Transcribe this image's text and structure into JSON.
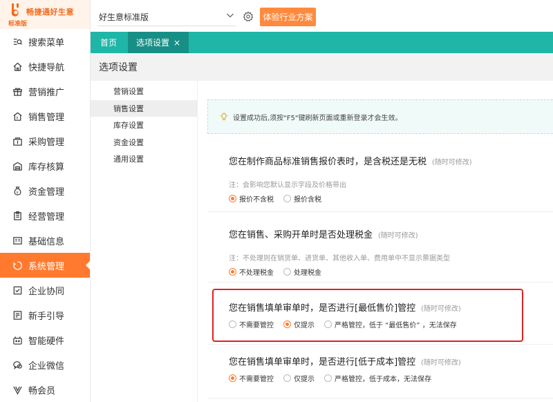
{
  "brand": {
    "name": "畅捷通好生意",
    "edition": "标准版",
    "accent": "#ff7a2e",
    "teal": "#1fb6a8"
  },
  "sidebar": {
    "items": [
      {
        "label": "搜索菜单",
        "icon": "search-menu-icon"
      },
      {
        "label": "快捷导航",
        "icon": "home-icon"
      },
      {
        "label": "营销推广",
        "icon": "gift-icon"
      },
      {
        "label": "销售管理",
        "icon": "sales-icon"
      },
      {
        "label": "采购管理",
        "icon": "purchase-icon"
      },
      {
        "label": "库存核算",
        "icon": "warehouse-icon"
      },
      {
        "label": "资金管理",
        "icon": "money-bag-icon"
      },
      {
        "label": "经营管理",
        "icon": "clipboard-icon"
      },
      {
        "label": "基础信息",
        "icon": "info-card-icon"
      },
      {
        "label": "系统管理",
        "icon": "system-icon",
        "active": true
      },
      {
        "label": "企业协同",
        "icon": "collab-icon"
      },
      {
        "label": "新手引导",
        "icon": "guide-icon"
      },
      {
        "label": "智能硬件",
        "icon": "hardware-icon"
      },
      {
        "label": "企业微信",
        "icon": "wechat-icon"
      },
      {
        "label": "畅会员",
        "icon": "vip-icon"
      }
    ]
  },
  "header": {
    "version_select": "好生意标准版",
    "experience_button": "体验行业方案"
  },
  "tabs": [
    {
      "label": "首页"
    },
    {
      "label": "选项设置",
      "active": true,
      "close": "×"
    }
  ],
  "page_title": "选项设置",
  "subnav": [
    {
      "label": "营销设置"
    },
    {
      "label": "销售设置",
      "active": true
    },
    {
      "label": "库存设置"
    },
    {
      "label": "资金设置"
    },
    {
      "label": "通用设置"
    }
  ],
  "notice": "设置成功后,须按\"F5\"键刷新页面或重新登录才会生效。",
  "sections": [
    {
      "title": "您在制作商品标准销售报价表时，是含税还是无税",
      "tip": "(随时可修改)",
      "note": "注：会影响您默认显示字段及价格带出",
      "options": [
        {
          "label": "报价不含税",
          "checked": true
        },
        {
          "label": "报价含税",
          "checked": false
        }
      ]
    },
    {
      "title": "您在销售、采购开单时是否处理税金",
      "tip": "(随时可修改)",
      "note": "注：不处理则在销货单、进货单、其他收入单、费用单中不显示票据类型",
      "options": [
        {
          "label": "不处理税金",
          "checked": true
        },
        {
          "label": "处理税金",
          "checked": false
        }
      ]
    },
    {
      "title": "您在销售填单审单时，是否进行[最低售价]管控",
      "tip": "(随时可修改)",
      "note": "",
      "options": [
        {
          "label": "不需要管控",
          "checked": false
        },
        {
          "label": "仅提示",
          "checked": true
        },
        {
          "label": "严格管控，低于 “最低售价” ，无法保存",
          "checked": false
        }
      ]
    },
    {
      "title": "您在销售填单审单时，是否进行[低于成本]管控",
      "tip": "(随时可修改)",
      "note": "",
      "options": [
        {
          "label": "不需要管控",
          "checked": true
        },
        {
          "label": "仅提示",
          "checked": false
        },
        {
          "label": "严格管控，低于成本，无法保存",
          "checked": false
        }
      ]
    }
  ]
}
